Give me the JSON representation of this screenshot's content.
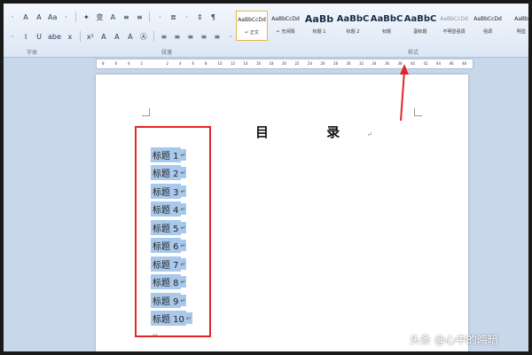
{
  "ribbon": {
    "row1": [
      "·",
      "A",
      "A",
      "Aa",
      "·",
      "✦",
      "变",
      "A",
      "≡",
      "≡",
      "·",
      "≣",
      "·",
      "⇕",
      "¶"
    ],
    "row2": [
      "·",
      "I",
      "U",
      "abe",
      "x",
      "x²",
      "A",
      "A",
      "A",
      "Ⓐ",
      "≡",
      "≡",
      "≡",
      "≡",
      "≡",
      "·",
      "⇕",
      "·"
    ],
    "group_labels": {
      "font": "字体",
      "paragraph": "段落",
      "styles": "样式"
    },
    "styles": [
      {
        "preview": "AaBbCcDd",
        "name": "↵ 正文",
        "selected": true,
        "kind": "small"
      },
      {
        "preview": "AaBbCcDd",
        "name": "↵ 无间隔",
        "selected": false,
        "kind": "small"
      },
      {
        "preview": "AaBb",
        "name": "标题 1",
        "selected": false,
        "kind": "big"
      },
      {
        "preview": "AaBbC",
        "name": "标题 2",
        "selected": false,
        "kind": "mid"
      },
      {
        "preview": "AaBbC",
        "name": "标题",
        "selected": false,
        "kind": "mid"
      },
      {
        "preview": "AaBbC",
        "name": "副标题",
        "selected": false,
        "kind": "mid"
      },
      {
        "preview": "AaBbCcDd",
        "name": "不明显强调",
        "selected": false,
        "kind": "faint"
      },
      {
        "preview": "AaBbCcDd",
        "name": "强调",
        "selected": false,
        "kind": "small"
      },
      {
        "preview": "AaBb",
        "name": "明显",
        "selected": false,
        "kind": "small"
      }
    ]
  },
  "ruler": {
    "numbers": [
      "8",
      "6",
      "4",
      "2",
      "",
      "2",
      "4",
      "6",
      "8",
      "10",
      "12",
      "14",
      "16",
      "18",
      "20",
      "22",
      "24",
      "26",
      "28",
      "30",
      "32",
      "34",
      "36",
      "38",
      "40",
      "42",
      "44",
      "46",
      "48"
    ]
  },
  "document": {
    "title": "目 录",
    "title_mark": "↵",
    "toc_items": [
      {
        "text": "标题 1",
        "mark": "↵"
      },
      {
        "text": "标题 2",
        "mark": "↵"
      },
      {
        "text": "标题 3",
        "mark": "↵"
      },
      {
        "text": "标题 4",
        "mark": "↵"
      },
      {
        "text": "标题 5",
        "mark": "↵"
      },
      {
        "text": "标题 6",
        "mark": "↵"
      },
      {
        "text": "标题 7",
        "mark": "↵"
      },
      {
        "text": "标题 8",
        "mark": "↵"
      },
      {
        "text": "标题 9",
        "mark": "↵"
      },
      {
        "text": "标题 10",
        "mark": "↵"
      }
    ],
    "end_mark": "↵"
  },
  "watermark": "头条 @心中的晦暗",
  "colors": {
    "annotation_red": "#e0262b",
    "selection_blue": "#a9c9ec",
    "ribbon_bg": "#dce7f5"
  }
}
